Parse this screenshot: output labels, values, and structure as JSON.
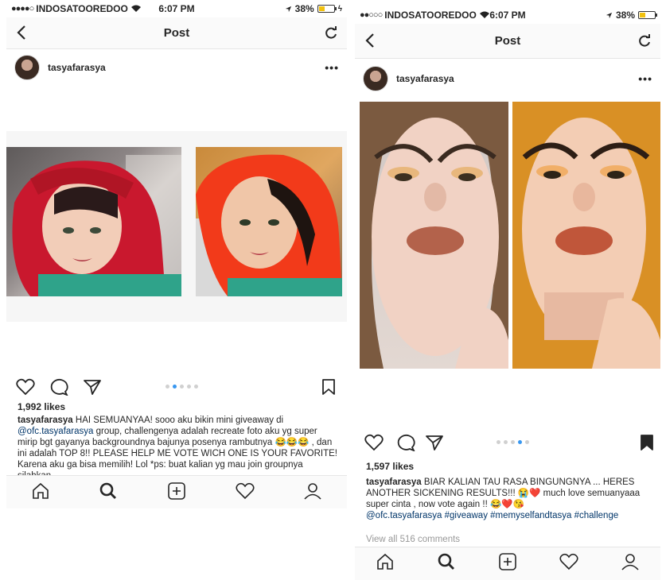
{
  "left": {
    "status": {
      "carrier": "INDOSATOOREDOO",
      "time": "6:07 PM",
      "battery": "38%",
      "battery_level": 0.38
    },
    "nav": {
      "title": "Post"
    },
    "post": {
      "username": "tasyafarasya",
      "more": "•••",
      "likes": "1,992 likes",
      "caption_user": "tasyafarasya",
      "caption_part1": "HAI SEMUANYAA! sooo aku bikin mini giveaway di",
      "caption_mention": "@ofc.tasyafarasya",
      "caption_part2": "group, challengenya adalah recreate foto aku yg super mirip bgt gayanya backgroundnya bajunya posenya rambutnya 😂😂😂 , dan ini adalah TOP 8!! PLEASE HELP ME VOTE WICH ONE IS YOUR FAVORITE! Karena aku ga bisa memilih! Lol *ps: buat kalian yg mau join groupnya silahkan"
    }
  },
  "right": {
    "status": {
      "carrier": "INDOSATOOREDOO",
      "time": "6:07 PM",
      "battery": "38%",
      "battery_level": 0.38
    },
    "nav": {
      "title": "Post"
    },
    "post": {
      "username": "tasyafarasya",
      "more": "•••",
      "likes": "1,597 likes",
      "caption_user": "tasyafarasya",
      "caption_part1": "BIAR KALIAN TAU RASA BINGUNGNYA ... HERES ANOTHER SICKENING RESULTS!!! 😭❤️ much love semuanyaaa super cinta , now vote again !! 😂❤️😘",
      "caption_tags": "@ofc.tasyafarasya #giveaway #memyselfandtasya #challenge",
      "view_all": "View all 516 comments"
    }
  },
  "colors": {
    "link": "#003569",
    "accent": "#3897f0",
    "muted": "#999999"
  }
}
